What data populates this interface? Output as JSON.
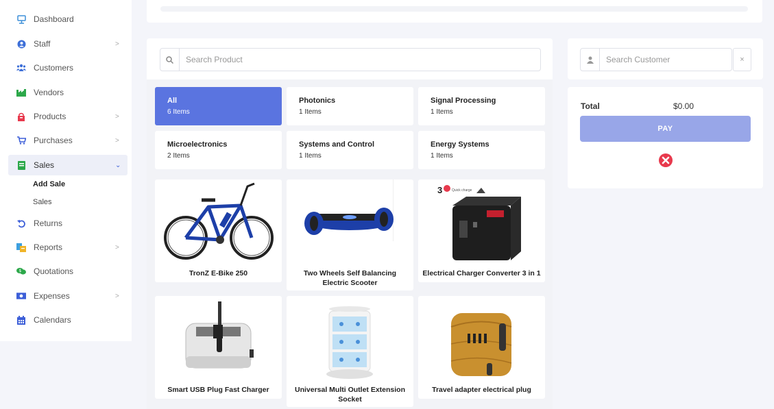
{
  "sidebar": {
    "items": [
      {
        "label": "Dashboard",
        "icon": "dashboard-icon",
        "chevron": false
      },
      {
        "label": "Staff",
        "icon": "user-icon",
        "chevron": true
      },
      {
        "label": "Customers",
        "icon": "users-icon",
        "chevron": false
      },
      {
        "label": "Vendors",
        "icon": "industry-icon",
        "chevron": false
      },
      {
        "label": "Products",
        "icon": "box-icon",
        "chevron": true
      },
      {
        "label": "Purchases",
        "icon": "cart-icon",
        "chevron": true
      },
      {
        "label": "Sales",
        "icon": "receipt-icon",
        "chevron": true,
        "expanded": true
      },
      {
        "label": "Returns",
        "icon": "undo-icon",
        "chevron": false
      },
      {
        "label": "Reports",
        "icon": "report-icon",
        "chevron": true
      },
      {
        "label": "Quotations",
        "icon": "comments-dollar-icon",
        "chevron": false
      },
      {
        "label": "Expenses",
        "icon": "money-bill-icon",
        "chevron": true
      },
      {
        "label": "Calendars",
        "icon": "calendar-icon",
        "chevron": false
      }
    ],
    "sales_sub": [
      {
        "label": "Add Sale",
        "current": true
      },
      {
        "label": "Sales",
        "current": false
      }
    ]
  },
  "search": {
    "placeholder": "Search Product"
  },
  "categories": [
    {
      "name": "All",
      "count": "6 Items",
      "selected": true
    },
    {
      "name": "Photonics",
      "count": "1 Items"
    },
    {
      "name": "Signal Processing",
      "count": "1 Items"
    },
    {
      "name": "Microelectronics",
      "count": "2 Items"
    },
    {
      "name": "Systems and Control",
      "count": "1 Items"
    },
    {
      "name": "Energy Systems",
      "count": "1 Items"
    }
  ],
  "products": [
    {
      "name": "TronZ E-Bike 250",
      "image": "ebike-image"
    },
    {
      "name": "Two Wheels Self Balancing Electric Scooter",
      "image": "hoverboard-image"
    },
    {
      "name": "Electrical Charger Converter 3 in 1",
      "image": "travel-charger-image",
      "image_text": "Quick charge"
    },
    {
      "name": "Smart USB Plug Fast Charger",
      "image": "usb-charger-image"
    },
    {
      "name": "Universal Multi Outlet Extension Socket",
      "image": "power-tower-image"
    },
    {
      "name": "Travel adapter electrical plug",
      "image": "wood-adapter-image"
    }
  ],
  "customer": {
    "placeholder": "Search Customer",
    "clear": "×"
  },
  "cart": {
    "total_label": "Total",
    "total_value": "$0.00",
    "pay_label": "PAY"
  },
  "colors": {
    "accent": "#5a74e0",
    "pay": "#98a6e8",
    "cancel": "#e8394d"
  }
}
